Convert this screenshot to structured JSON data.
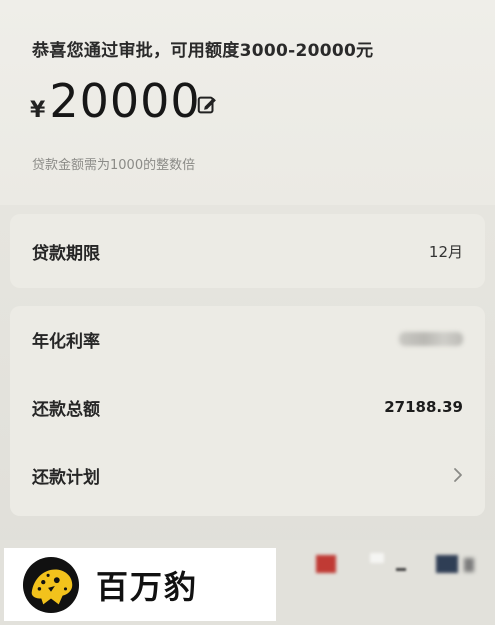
{
  "approval": {
    "headline": "恭喜您通过审批，可用额度3000-20000元",
    "currency": "¥",
    "amount": "20000",
    "hint": "贷款金额需为1000的整数倍"
  },
  "term": {
    "label": "贷款期限",
    "value": "12月"
  },
  "details": {
    "rate_label": "年化利率",
    "total_label": "还款总额",
    "total_value": "27188.39",
    "plan_label": "还款计划"
  },
  "watermark": {
    "name": "百万豹"
  },
  "icons": {
    "edit": "edit-icon",
    "chevron": "chevron-right-icon",
    "logo": "leopard-logo-icon"
  }
}
